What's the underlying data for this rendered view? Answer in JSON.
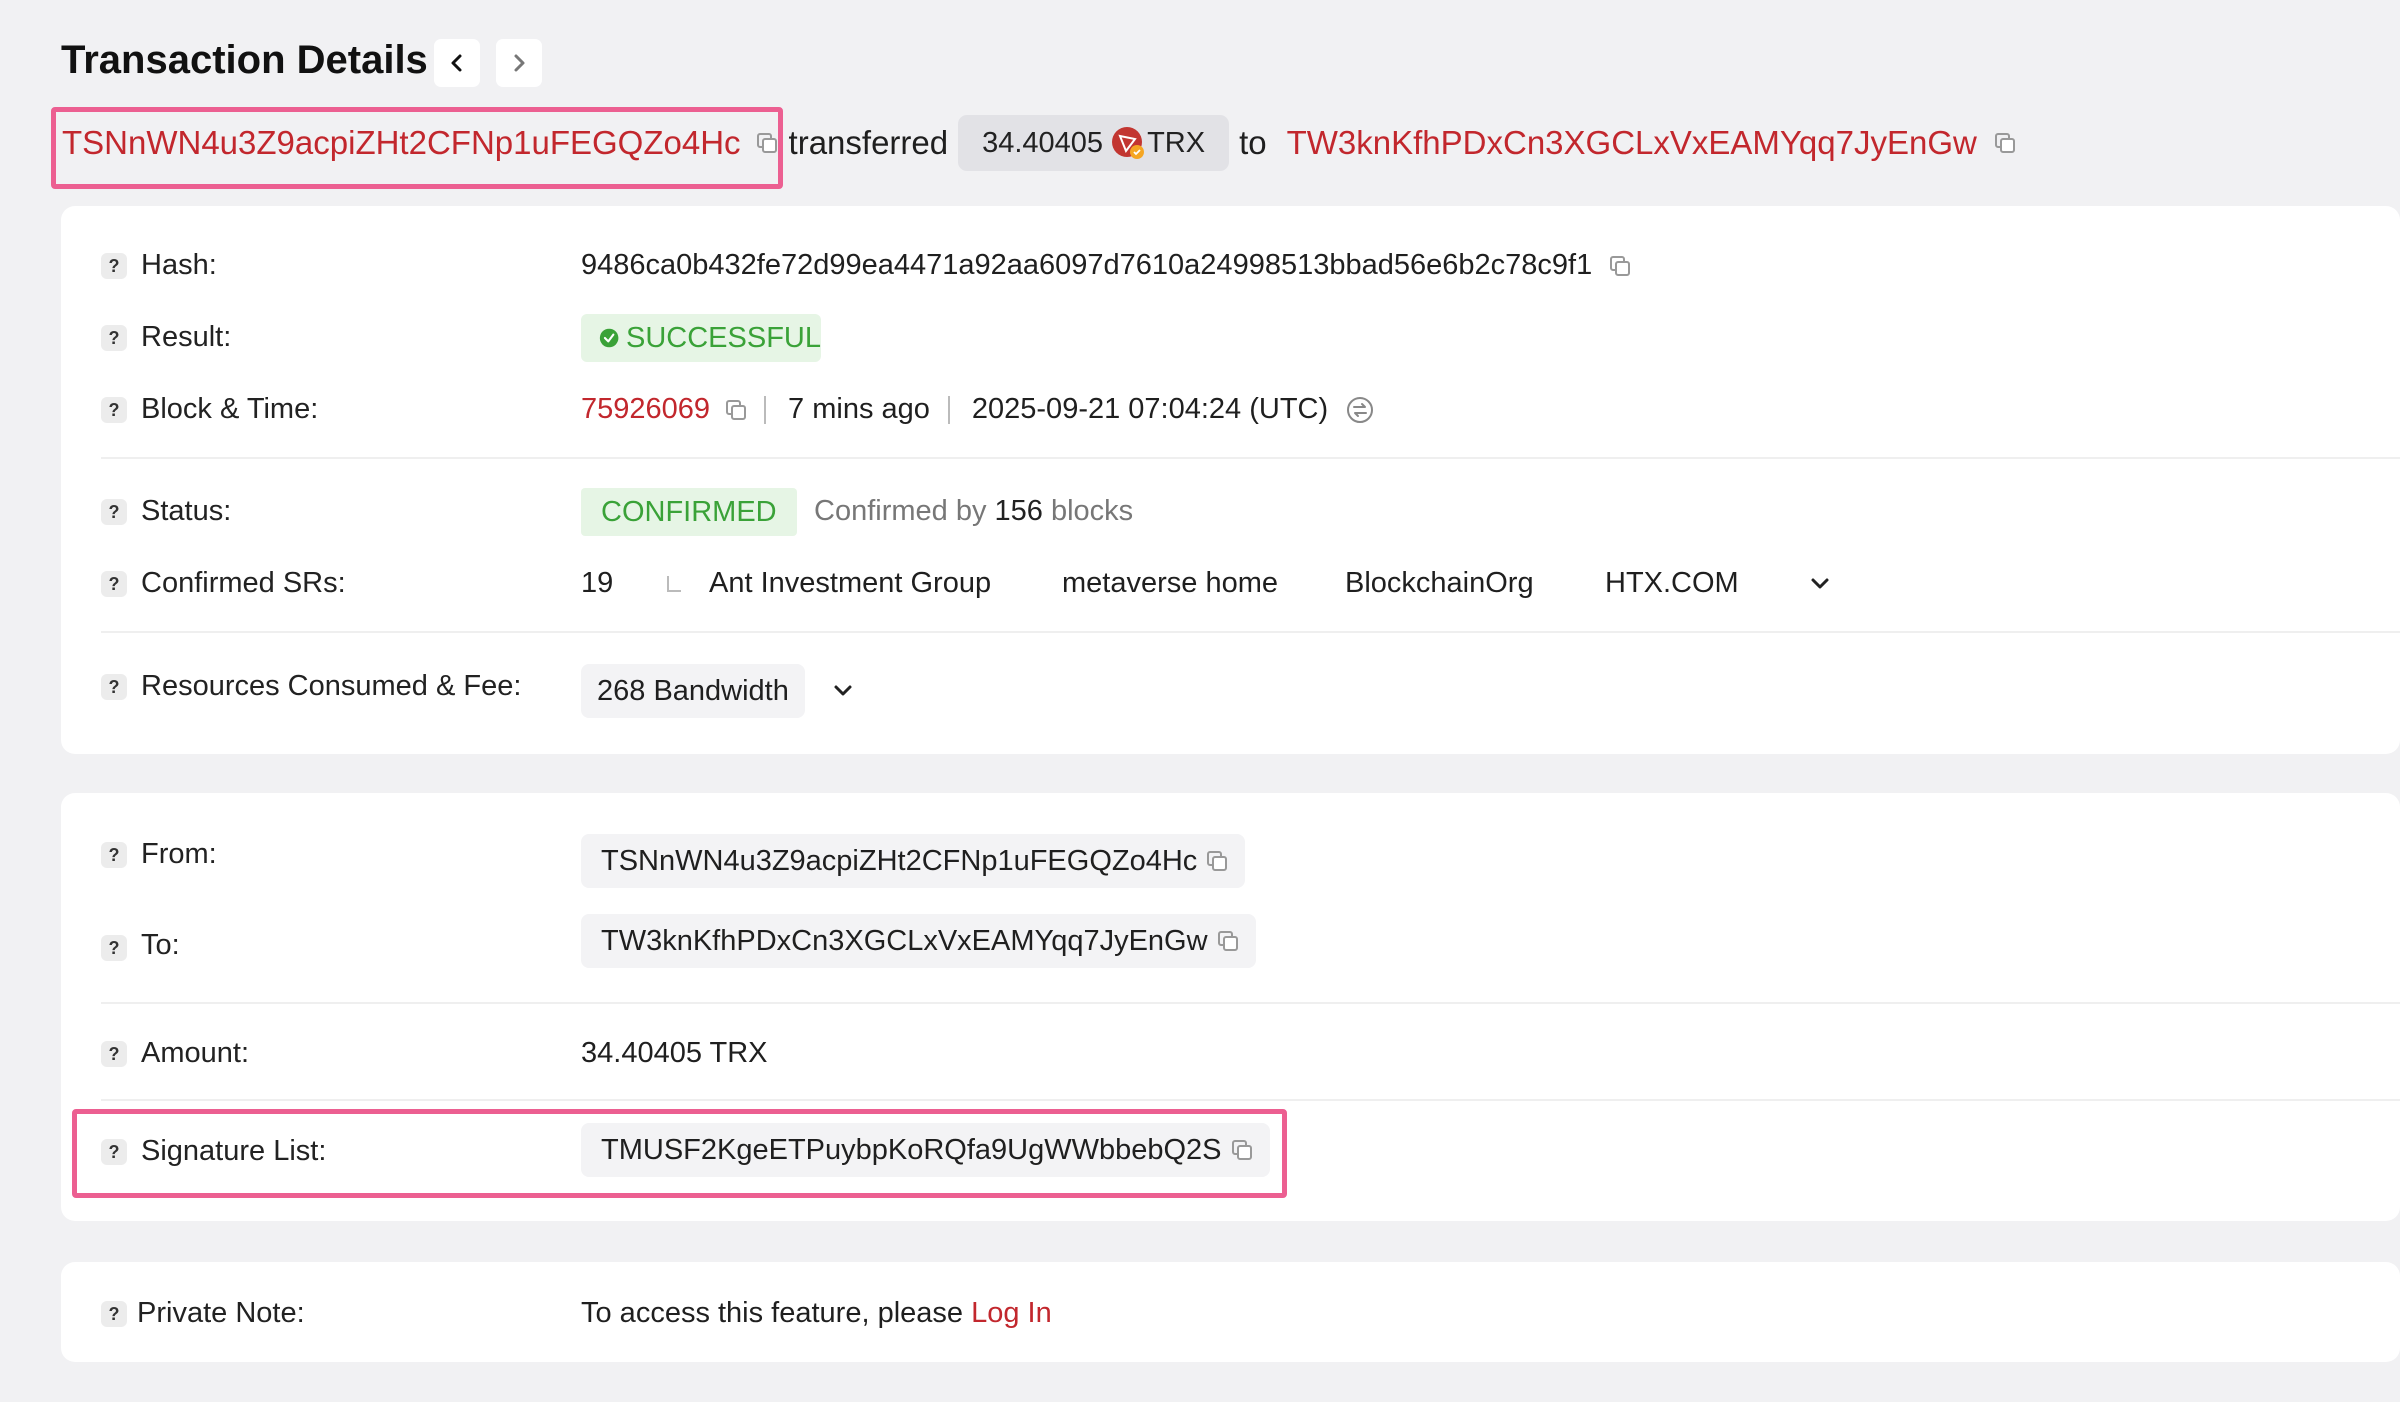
{
  "header": {
    "title": "Transaction Details"
  },
  "summary": {
    "from_address": "TSNnWN4u3Z9acpiZHt2CFNp1uFEGQZo4Hc",
    "action_word": "transferred",
    "amount": "34.40405",
    "token": "TRX",
    "to_word": "to",
    "to_address": "TW3knKfhPDxCn3XGCLxVxEAMYqq7JyEnGw"
  },
  "details": {
    "hash_label": "Hash:",
    "hash_value": "9486ca0b432fe72d99ea4471a92aa6097d7610a24998513bbad56e6b2c78c9f1",
    "result_label": "Result:",
    "result_value": "SUCCESSFUL",
    "block_label": "Block & Time:",
    "block_number": "75926069",
    "block_age": "7 mins ago",
    "block_time": "2025-09-21 07:04:24 (UTC)",
    "status_label": "Status:",
    "status_value": "CONFIRMED",
    "confirmed_by_prefix": "Confirmed by",
    "confirmed_by_count": "156",
    "confirmed_by_suffix": "blocks",
    "srs_label": "Confirmed SRs:",
    "srs_count": "19",
    "srs": [
      "Ant Investment Group",
      "metaverse home",
      "BlockchainOrg",
      "HTX.COM"
    ],
    "resources_label": "Resources Consumed & Fee:",
    "resources_value": "268 Bandwidth"
  },
  "transfer": {
    "from_label": "From:",
    "from_value": "TSNnWN4u3Z9acpiZHt2CFNp1uFEGQZo4Hc",
    "to_label": "To:",
    "to_value": "TW3knKfhPDxCn3XGCLxVxEAMYqq7JyEnGw",
    "amount_label": "Amount:",
    "amount_value": "34.40405 TRX",
    "signature_label": "Signature List:",
    "signature_value": "TMUSF2KgeETPuybpKoRQfa9UgWWbbebQ2S"
  },
  "note": {
    "label": "Private Note:",
    "text": "To access this feature, please",
    "login_link": "Log In"
  },
  "colors": {
    "link_red": "#c2272d",
    "success_green": "#3aa238",
    "highlight_pink": "#ec5f91",
    "page_bg": "#f1f1f3"
  },
  "icons": [
    "chevron-left-icon",
    "chevron-right-icon",
    "copy-icon",
    "trx-token-icon",
    "check-circle-icon",
    "timezone-toggle-icon",
    "chevron-down-icon",
    "help-icon"
  ]
}
